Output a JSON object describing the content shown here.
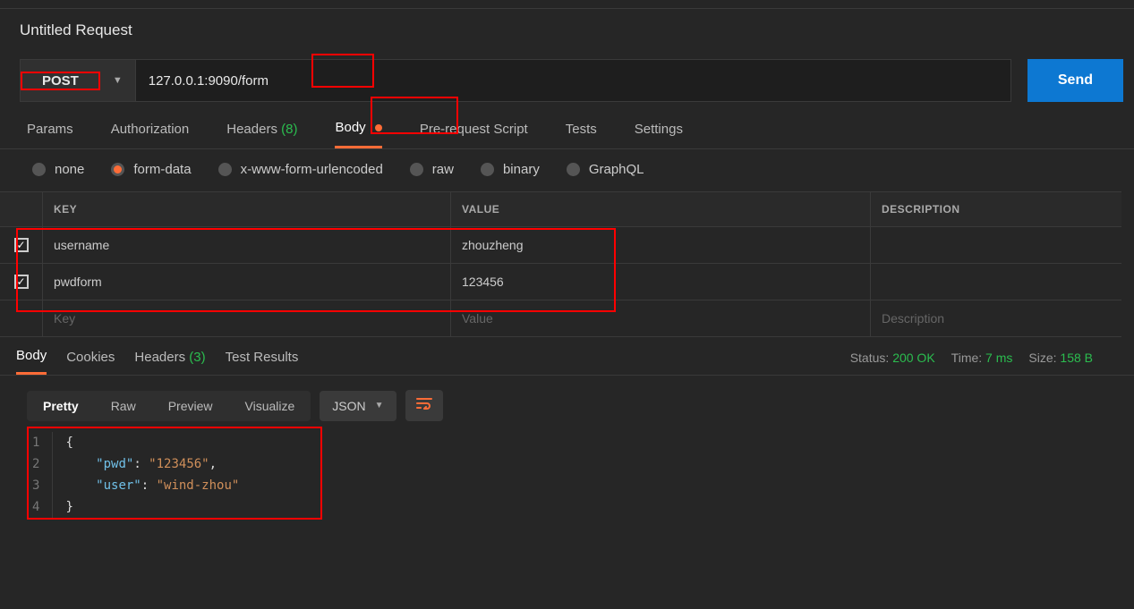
{
  "request": {
    "title": "Untitled Request",
    "method": "POST",
    "url": "127.0.0.1:9090/form",
    "send_label": "Send"
  },
  "tabs": {
    "params": "Params",
    "auth": "Authorization",
    "headers": "Headers",
    "headers_count": "(8)",
    "body": "Body",
    "prerequest": "Pre-request Script",
    "tests": "Tests",
    "settings": "Settings"
  },
  "body_types": {
    "none": "none",
    "formdata": "form-data",
    "urlencoded": "x-www-form-urlencoded",
    "raw": "raw",
    "binary": "binary",
    "graphql": "GraphQL"
  },
  "params_table": {
    "header_key": "KEY",
    "header_value": "VALUE",
    "header_desc": "DESCRIPTION",
    "rows": [
      {
        "key": "username",
        "value": "zhouzheng"
      },
      {
        "key": "pwdform",
        "value": "123456"
      }
    ],
    "ph_key": "Key",
    "ph_value": "Value",
    "ph_desc": "Description"
  },
  "response": {
    "tabs": {
      "body": "Body",
      "cookies": "Cookies",
      "headers": "Headers",
      "headers_count": "(3)",
      "testresults": "Test Results"
    },
    "status_label": "Status:",
    "status_value": "200 OK",
    "time_label": "Time:",
    "time_value": "7 ms",
    "size_label": "Size:",
    "size_value": "158 B",
    "views": {
      "pretty": "Pretty",
      "raw": "Raw",
      "preview": "Preview",
      "visualize": "Visualize"
    },
    "format": "JSON",
    "body_lines": [
      "{",
      "    \"pwd\": \"123456\",",
      "    \"user\": \"wind-zhou\"",
      "}"
    ]
  }
}
